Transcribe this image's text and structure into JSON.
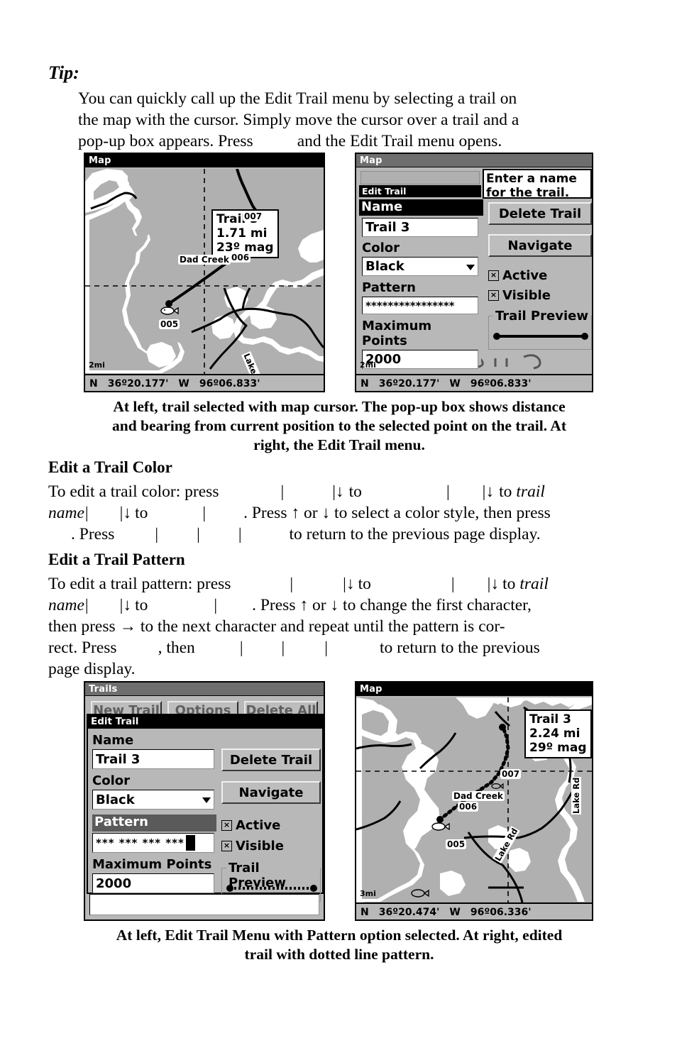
{
  "tip": {
    "heading": "Tip:",
    "line1": "You can quickly call up the Edit Trail menu by selecting a trail on",
    "line2": "the map with the cursor. Simply move the cursor over a trail and a",
    "line3_a": "pop-up box appears. Press",
    "line3_b": "and the Edit Trail menu opens."
  },
  "figure1": {
    "left": {
      "title": "Map",
      "scale": "2mi",
      "popup": {
        "name": "Trail 3",
        "distance": "1.71 mi",
        "bearing": "23º mag"
      },
      "labels": {
        "wp007": "007",
        "wp006": "006",
        "wp005": "005",
        "creek": "Dad Creek",
        "road": "Lake Rd"
      },
      "status": {
        "lat_dir": "N",
        "lat": "36º20.177'",
        "lon_dir": "W",
        "lon": "96º06.833'"
      }
    },
    "right": {
      "title": "Map",
      "scale": "2mi",
      "dialog_title": "Edit Trail",
      "tooltip": "Enter a name for the trail.",
      "fields": {
        "name_label": "Name",
        "name_value": "Trail 3",
        "color_label": "Color",
        "color_value": "Black",
        "pattern_label": "Pattern",
        "pattern_value": "****************",
        "maxpoints_label": "Maximum Points",
        "maxpoints_value": "2000"
      },
      "buttons": {
        "delete": "Delete Trail",
        "navigate": "Navigate"
      },
      "checkboxes": [
        {
          "label": "Active",
          "checked": true,
          "mark": "×"
        },
        {
          "label": "Visible",
          "checked": true,
          "mark": "×"
        }
      ],
      "preview_label": "Trail Preview",
      "status": {
        "lat_dir": "N",
        "lat": "36º20.177'",
        "lon_dir": "W",
        "lon": "96º06.833'"
      }
    },
    "caption_line1": "At left, trail selected with map cursor. The pop-up box shows distance",
    "caption_line2": "and bearing from current position to the selected point on the trail. At",
    "caption_line3": "right, the Edit Trail menu."
  },
  "section_color": {
    "heading": "Edit a Trail Color",
    "line1_a": "To edit a trail color: press",
    "line1_b": "to",
    "line1_c": "to",
    "line1_d": "trail",
    "line2_a": "name",
    "line2_b": "to",
    "line2_c": ". Press ↑ or ↓ to select a color style, then press",
    "line3_a": ". Press",
    "line3_b": "to return to the previous page display."
  },
  "section_pattern": {
    "heading": "Edit a Trail Pattern",
    "line1_a": "To edit a trail pattern: press",
    "line1_b": "to",
    "line1_c": "to",
    "line1_d": "trail",
    "line2_a": "name",
    "line2_b": "to",
    "line2_c": ". Press ↑ or ↓ to change the first character,",
    "line3": "then press → to the next character and repeat until the pattern is cor-",
    "line4_a": "rect. Press",
    "line4_b": ", then",
    "line4_c": "to return to the previous",
    "line5": "page display."
  },
  "figure2": {
    "left": {
      "title": "Trails",
      "behind_buttons": [
        "New Trail",
        "Options",
        "Delete All"
      ],
      "dialog_title": "Edit Trail",
      "fields": {
        "name_label": "Name",
        "name_value": "Trail 3",
        "color_label": "Color",
        "color_value": "Black",
        "pattern_label": "Pattern",
        "pattern_value": "***  ***  ***  ***",
        "maxpoints_label": "Maximum Points",
        "maxpoints_value": "2000"
      },
      "buttons": {
        "delete": "Delete Trail",
        "navigate": "Navigate"
      },
      "checkboxes": [
        {
          "label": "Active",
          "checked": true,
          "mark": "×"
        },
        {
          "label": "Visible",
          "checked": true,
          "mark": "×"
        }
      ],
      "preview_label": "Trail Preview"
    },
    "right": {
      "title": "Map",
      "scale": "3mi",
      "popup": {
        "name": "Trail 3",
        "distance": "2.24 mi",
        "bearing": "29º mag"
      },
      "labels": {
        "wp007": "007",
        "wp006": "006",
        "wp005": "005",
        "creek": "Dad Creek",
        "road1": "Lake Rd",
        "road2": "Lake Rd"
      },
      "status": {
        "lat_dir": "N",
        "lat": "36º20.474'",
        "lon_dir": "W",
        "lon": "96º06.336'"
      }
    },
    "caption_line1": "At left, Edit Trail Menu with Pattern option selected. At right, edited",
    "caption_line2": "trail with dotted line pattern."
  },
  "colors": {
    "lcd_bg": "#b8b8b8",
    "map_land": "#b0b0b0",
    "map_water": "#ffffff",
    "titlebar": "#6e6e6e",
    "selected": "#000000",
    "selected_gray": "#5a5a5a"
  }
}
